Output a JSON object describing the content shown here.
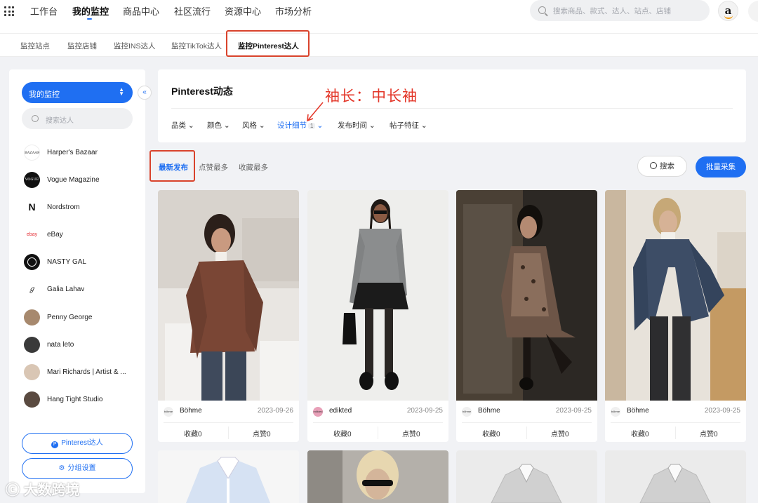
{
  "topnav": {
    "items": [
      "工作台",
      "我的监控",
      "商品中心",
      "社区流行",
      "资源中心",
      "市场分析"
    ],
    "search_placeholder": "搜索商品、款式、达人、站点、店铺",
    "avatar_letter": "a"
  },
  "subnav": {
    "tabs": [
      "监控站点",
      "监控店铺",
      "监控INS达人",
      "监控TikTok达人",
      "监控Pinterest达人"
    ]
  },
  "sidebar": {
    "dropdown_label": "我的监控",
    "search_placeholder": "搜索达人",
    "accounts": [
      {
        "name": "Harper's Bazaar",
        "logo": "BAZAAR"
      },
      {
        "name": "Vogue Magazine",
        "logo": "VOGUE"
      },
      {
        "name": "Nordstrom",
        "logo": "N"
      },
      {
        "name": "eBay",
        "logo": "ebay"
      },
      {
        "name": "NASTY GAL",
        "logo": ""
      },
      {
        "name": "Galia Lahav",
        "logo": "GL"
      },
      {
        "name": "Penny George",
        "logo": ""
      },
      {
        "name": "nata leto",
        "logo": ""
      },
      {
        "name": "Mari Richards | Artist & ...",
        "logo": ""
      },
      {
        "name": "Hang Tight Studio",
        "logo": ""
      }
    ],
    "pinterest_button": "Pinterest达人",
    "group_button": "分组设置"
  },
  "filter": {
    "title": "Pinterest动态",
    "items": [
      "品类",
      "颜色",
      "风格",
      "设计细节",
      "发布时间",
      "帖子特征"
    ],
    "design_badge": "1",
    "annotation": "袖长：中长袖"
  },
  "sort": {
    "tabs": [
      "最新发布",
      "点赞最多",
      "收藏最多"
    ],
    "search_button": "搜索",
    "batch_button": "批量采集"
  },
  "cards": [
    {
      "brand": "Böhme",
      "logo": "böhme",
      "date": "2023-09-26",
      "fav": "收藏0",
      "like": "点赞0"
    },
    {
      "brand": "edikted",
      "logo": "edikted",
      "date": "2023-09-25",
      "fav": "收藏0",
      "like": "点赞0"
    },
    {
      "brand": "Böhme",
      "logo": "böhme",
      "date": "2023-09-25",
      "fav": "收藏0",
      "like": "点赞0"
    },
    {
      "brand": "Böhme",
      "logo": "böhme",
      "date": "2023-09-25",
      "fav": "收藏0",
      "like": "点赞0"
    }
  ],
  "watermark": "大数跨境",
  "colors": {
    "accent": "#1f6ff2",
    "annotation": "#e33527"
  }
}
